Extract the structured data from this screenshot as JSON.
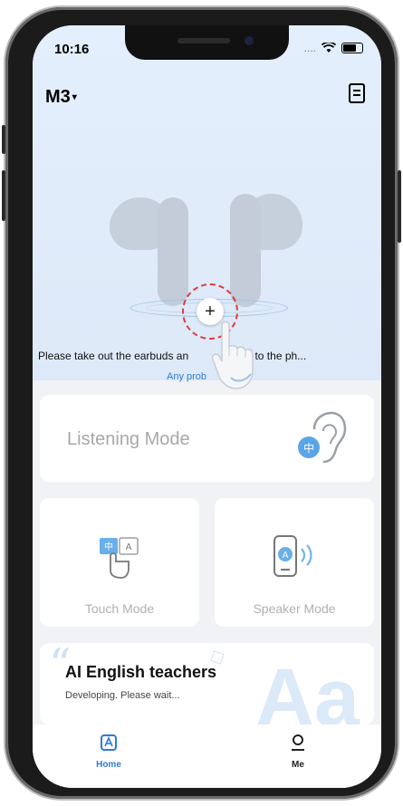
{
  "status_bar": {
    "time": "10:16",
    "dots": "...."
  },
  "header": {
    "device_name": "M3",
    "menu_icon": "document-icon"
  },
  "pairing": {
    "instruction": "Please take out the earbuds and put them closer to the ph...",
    "instruction_visible": "Please take out the earbuds an",
    "instruction_tail": "closer to the ph...",
    "help_link": "Any prob",
    "pair_symbol": "+"
  },
  "modes": {
    "listening": "Listening Mode",
    "touch": "Touch Mode",
    "speaker": "Speaker Mode"
  },
  "promo": {
    "title": "AI English teachers",
    "subtitle": "Developing. Please wait...",
    "decor_text": "Aa",
    "quote_mark": "“"
  },
  "tabbar": {
    "tabs": [
      {
        "label": "Home",
        "icon": "home-icon",
        "active": true
      },
      {
        "label": "Me",
        "icon": "person-icon",
        "active": false
      }
    ]
  },
  "colors": {
    "accent": "#2e7bd6",
    "top_bg": "#e3effc",
    "pair_ring": "#e23a3a"
  }
}
